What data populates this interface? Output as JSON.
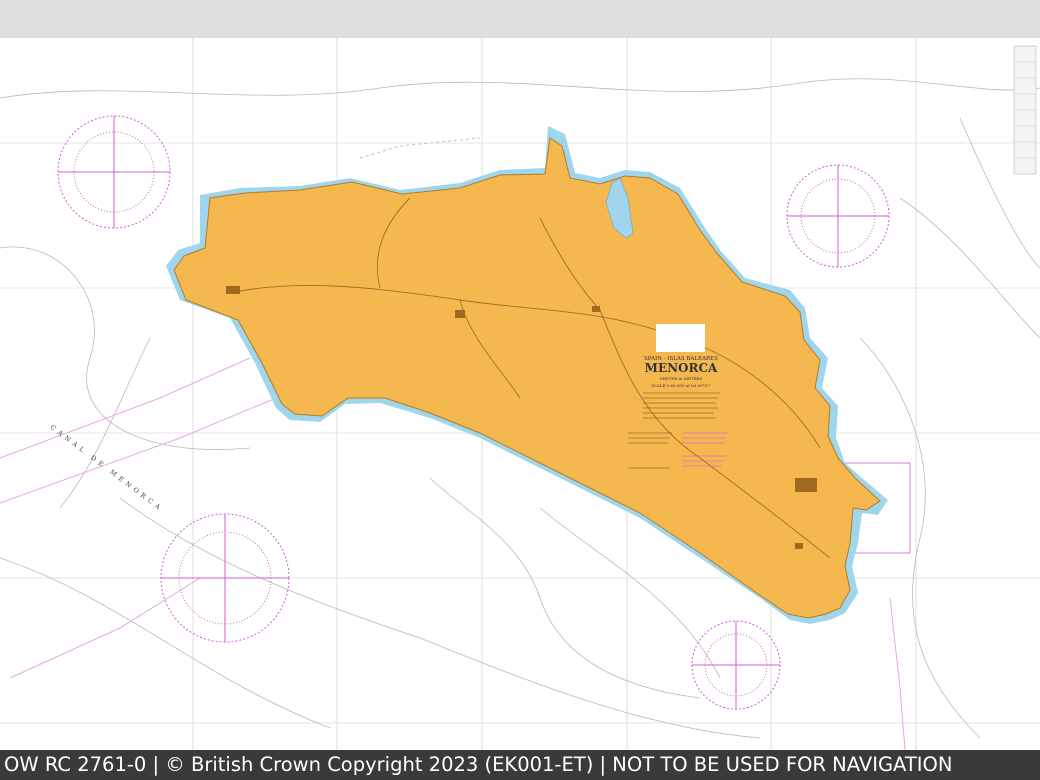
{
  "chart_title": {
    "region": "SPAIN - ISLAS BALEARES",
    "island": "MENORCA",
    "depths": "DEPTHS in METRES",
    "scale": "SCALE 1:60 000 at lat 39°57'"
  },
  "channel_label": "CANAL DE MENORCA",
  "footer_text": "OW RC 2761-0 | © British Crown Copyright 2023 (EK001-ET) | NOT TO BE USED FOR NAVIGATION",
  "colors": {
    "land": "#f5b84f",
    "shallow_water": "#9fd6ee",
    "magenta": "#d55bd9",
    "footer_bg": "#3a3a3a"
  }
}
